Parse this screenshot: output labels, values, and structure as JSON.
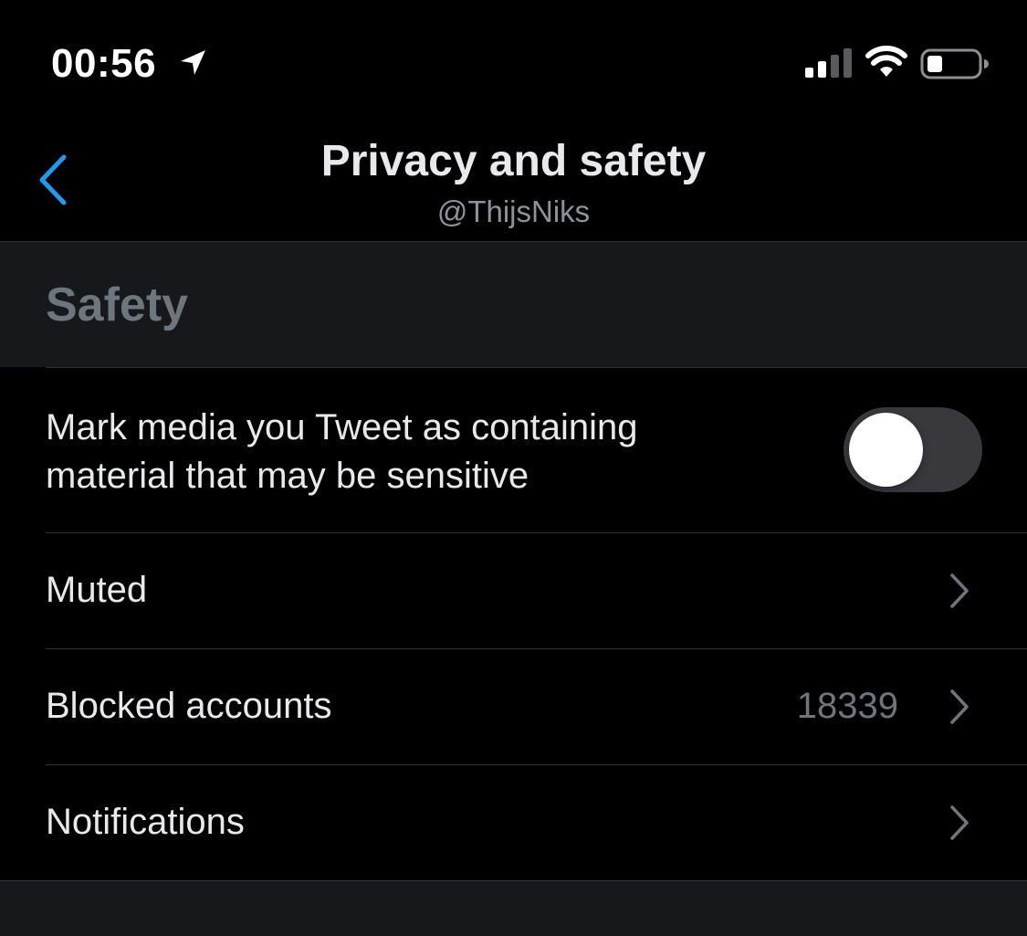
{
  "status_bar": {
    "time": "00:56",
    "icons": [
      "location-arrow-icon",
      "cellular-signal-icon",
      "wifi-icon",
      "battery-icon"
    ]
  },
  "header": {
    "title": "Privacy and safety",
    "subtitle": "@ThijsNiks",
    "back_icon": "chevron-left-icon"
  },
  "section": {
    "title": "Safety"
  },
  "rows": [
    {
      "label_line1": "Mark media you Tweet as containing",
      "label_line2": "material that may be sensitive",
      "control": "toggle",
      "toggle_on": false
    },
    {
      "label": "Muted",
      "control": "chevron-right-icon"
    },
    {
      "label": "Blocked accounts",
      "value": "18339",
      "control": "chevron-right-icon"
    },
    {
      "label": "Notifications",
      "control": "chevron-right-icon"
    }
  ],
  "colors": {
    "background": "#000000",
    "section_background": "#16181c",
    "accent": "#1d9bf0",
    "divider": "#2f3336",
    "secondary_text": "#6e767d",
    "toggle_off_track": "#39393d"
  }
}
